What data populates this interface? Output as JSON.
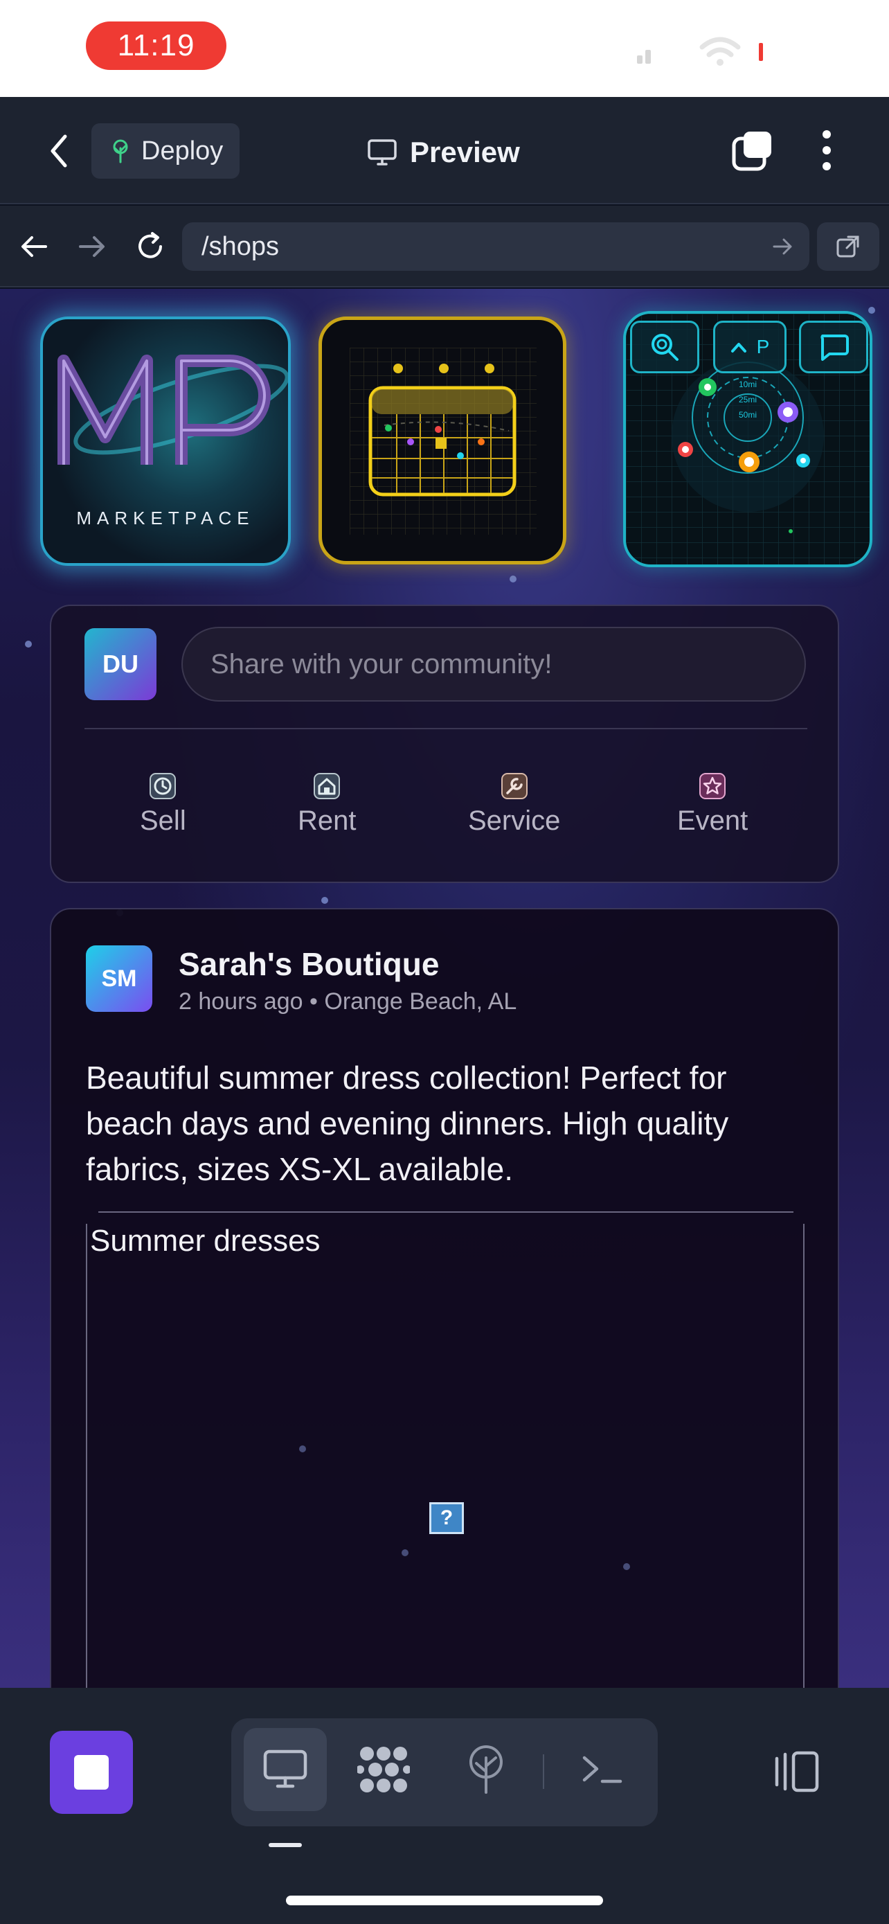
{
  "status_bar": {
    "time": "11:19"
  },
  "top_bar": {
    "deploy_label": "Deploy",
    "preview_label": "Preview"
  },
  "url_bar": {
    "url": "/shops"
  },
  "feature_tiles": {
    "marketplace_logo_text": "MARKETPACE",
    "radar_button_label": "P",
    "radar_ring_labels": [
      "10mi",
      "25mi",
      "50mi"
    ]
  },
  "composer": {
    "avatar_initials": "DU",
    "placeholder": "Share with your community!",
    "actions": [
      {
        "label": "Sell",
        "icon": "clock-icon"
      },
      {
        "label": "Rent",
        "icon": "home-icon"
      },
      {
        "label": "Service",
        "icon": "wrench-icon"
      },
      {
        "label": "Event",
        "icon": "star-icon"
      }
    ]
  },
  "post": {
    "avatar_initials": "SM",
    "author": "Sarah's Boutique",
    "meta": "2 hours ago • Orange Beach, AL",
    "body": "Beautiful summer dress collection! Perfect for beach days and evening dinners. High quality fabrics, sizes XS-XL available.",
    "image_alt": "Summer dresses",
    "broken_image_glyph": "?"
  },
  "bottom_bar": {
    "tabs": [
      "monitor-icon",
      "grid-pattern-icon",
      "deploy-tree-icon",
      "terminal-icon"
    ],
    "active_tab": "monitor-icon"
  },
  "colors": {
    "accent_purple": "#6b3fe0",
    "time_pill": "#ef3a33",
    "calendar_gold": "#c9a517",
    "radar_cyan": "#1fb3c6"
  }
}
